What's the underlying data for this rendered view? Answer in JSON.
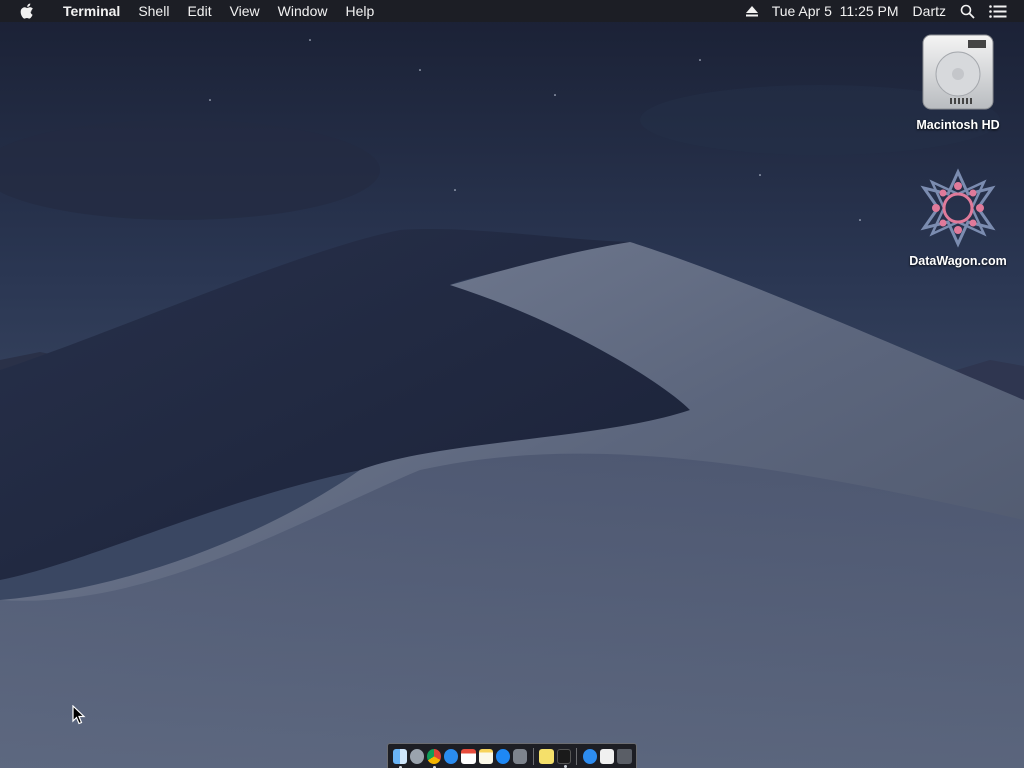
{
  "menubar": {
    "app_name": "Terminal",
    "menus": [
      "Shell",
      "Edit",
      "View",
      "Window",
      "Help"
    ],
    "clock": "Tue Apr 5  11:25 PM",
    "user": "Dartz"
  },
  "desktop_icons": [
    {
      "label": "Macintosh HD",
      "icon": "hard-drive-icon"
    },
    {
      "label": "DataWagon.com",
      "icon": "datawagon-logo-icon"
    }
  ],
  "dock": {
    "apps": [
      {
        "icon": "finder-icon",
        "running": true
      },
      {
        "icon": "launchpad-icon",
        "running": false
      },
      {
        "icon": "chrome-icon",
        "running": true
      },
      {
        "icon": "safari-icon",
        "running": false
      },
      {
        "icon": "calendar-icon",
        "running": false
      },
      {
        "icon": "notes-icon",
        "running": false
      },
      {
        "icon": "app-store-icon",
        "running": false
      },
      {
        "icon": "system-preferences-icon",
        "running": false
      },
      {
        "icon": "stickies-icon",
        "running": false
      },
      {
        "icon": "terminal-icon",
        "running": true
      },
      {
        "icon": "applications-folder-icon",
        "running": false
      },
      {
        "icon": "document-icon",
        "running": false
      },
      {
        "icon": "trash-icon",
        "running": false
      }
    ]
  },
  "colors": {
    "menubar": "#1c1e24",
    "sky_top": "#1b2236",
    "dune_light": "#8b94a8"
  }
}
